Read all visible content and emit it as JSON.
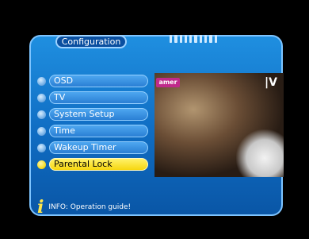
{
  "window": {
    "title": "Configuration"
  },
  "menu": {
    "items": [
      {
        "label": "OSD",
        "selected": false
      },
      {
        "label": "TV",
        "selected": false
      },
      {
        "label": "System Setup",
        "selected": false
      },
      {
        "label": "Time",
        "selected": false
      },
      {
        "label": "Wakeup Timer",
        "selected": false
      },
      {
        "label": "Parental Lock",
        "selected": true
      }
    ]
  },
  "preview": {
    "channel_logo": "amer",
    "brand": "|V"
  },
  "info": {
    "icon": "info-icon",
    "text": "INFO: Operation guide!"
  },
  "colors": {
    "accent_selected": "#f6d60f",
    "panel_blue": "#1f8fe0",
    "background": "#000000"
  }
}
